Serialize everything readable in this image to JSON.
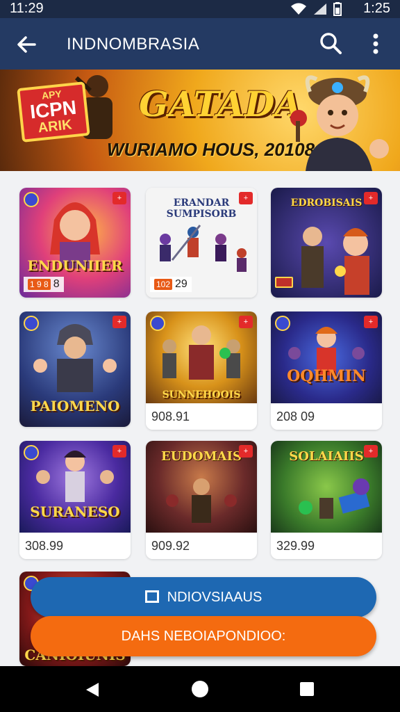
{
  "status_bar": {
    "time_left": "11:29",
    "time_right": "1:25"
  },
  "app_bar": {
    "title": "INDNOMBRASIA"
  },
  "banner": {
    "badge_line1": "APY",
    "badge_line2": "ICPN",
    "badge_line3": "ARIK",
    "headline": "GATADA",
    "subline": "WURIAMO HOUS, 20108"
  },
  "games": [
    {
      "title": "ENDUNIIER",
      "price": "8",
      "price_tag": "1 9 8",
      "style": "pink"
    },
    {
      "title": "ERANDAR SUMPISORB",
      "price": "29",
      "price_tag": "102",
      "style": "white"
    },
    {
      "title": "EDROBISAIS",
      "price": "",
      "price_tag": "",
      "style": "navy"
    },
    {
      "title": "PAIOMENO",
      "price": "",
      "price_tag": "",
      "style": "blue"
    },
    {
      "title": "SUNNEHOOIS",
      "price": "908.91",
      "price_tag": "",
      "style": "gold"
    },
    {
      "title": "OQHMIN",
      "price": "208 09",
      "price_tag": "",
      "style": "purple"
    },
    {
      "title": "SURANESO",
      "price": "308.99",
      "price_tag": "",
      "style": "violet"
    },
    {
      "title": "EUDOMAIS",
      "price": "909.92",
      "price_tag": "",
      "style": "brown"
    },
    {
      "title": "SOLAIAIIS",
      "price": "329.99",
      "price_tag": "",
      "style": "green"
    },
    {
      "title": "CANIOIUNIS",
      "price": "",
      "price_tag": "",
      "style": "red"
    }
  ],
  "actions": {
    "primary": "NDIOVSIAAUS",
    "secondary": "DAHS NEBOIAPONDIOO:"
  },
  "colors": {
    "app_bar": "#243a63",
    "primary_button": "#1e68b2",
    "secondary_button": "#f46b10"
  }
}
